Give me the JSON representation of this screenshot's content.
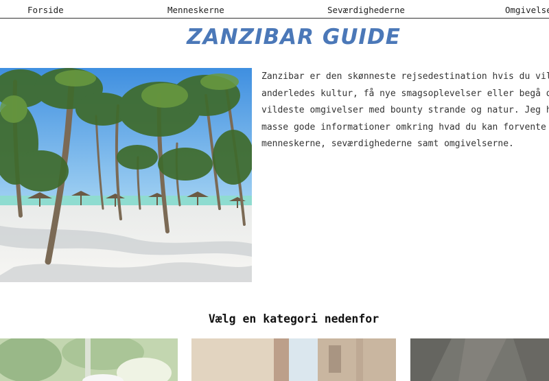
{
  "nav": {
    "items": [
      {
        "label": "Forside"
      },
      {
        "label": "Menneskerne"
      },
      {
        "label": "Seværdighederne"
      },
      {
        "label": "Omgivelserne"
      }
    ]
  },
  "header": {
    "title": "Zanzibar Guide"
  },
  "intro": {
    "lines": [
      "Zanzibar er den skønneste rejsedestination hvis du vil",
      "anderledes kultur, få nye smagsoplevelser eller begå dig",
      "vildeste omgivelser med bounty strande og natur. Jeg har",
      "masse gode informationer omkring hvad du kan forvente af",
      "menneskerne, seværdighederne samt omgivelserne."
    ]
  },
  "categories": {
    "heading": "Vælg en kategori nedenfor"
  },
  "colors": {
    "title_blue": "#4b78b8",
    "sky": "#5aa6e8",
    "sea": "#8fdcd0",
    "sand": "#f2f1ee"
  }
}
